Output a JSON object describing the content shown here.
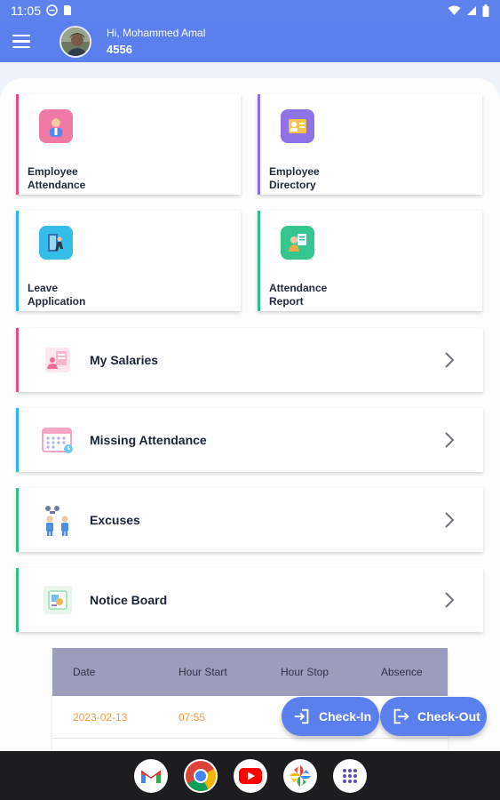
{
  "status_bar": {
    "time": "11:05"
  },
  "header": {
    "greeting": "Hi, Mohammed Amal",
    "user_id": "4556"
  },
  "tiles": [
    {
      "label": "Employee\nAttendance",
      "color": "#e84a8a",
      "icon": "employee-attendance-icon"
    },
    {
      "label": "Employee\nDirectory",
      "color": "#8c6fe0",
      "icon": "employee-directory-icon"
    },
    {
      "label": "Leave\nApplication",
      "color": "#27b8e6",
      "icon": "leave-application-icon"
    },
    {
      "label": "Attendance\nReport",
      "color": "#2fbf88",
      "icon": "attendance-report-icon"
    }
  ],
  "rows": [
    {
      "label": "My Salaries",
      "color": "#e84a8a",
      "icon": "salaries-icon"
    },
    {
      "label": "Missing Attendance",
      "color": "#27b8e6",
      "icon": "calendar-icon"
    },
    {
      "label": "Excuses",
      "color": "#2fbf88",
      "icon": "people-chat-icon"
    },
    {
      "label": "Notice Board",
      "color": "#2fbf88",
      "icon": "notice-board-icon"
    }
  ],
  "table": {
    "headers": [
      "Date",
      "Hour Start",
      "Hour Stop",
      "Absence"
    ],
    "rows": [
      [
        "2023-02-13",
        "07:55",
        "",
        ""
      ]
    ]
  },
  "actions": {
    "check_in": "Check-In",
    "check_out": "Check-Out"
  },
  "colors": {
    "primary": "#5b80ee",
    "accent_orange": "#f39a3e"
  },
  "dock": [
    "gmail-icon",
    "chrome-icon",
    "youtube-icon",
    "photos-icon",
    "app-drawer-icon"
  ]
}
